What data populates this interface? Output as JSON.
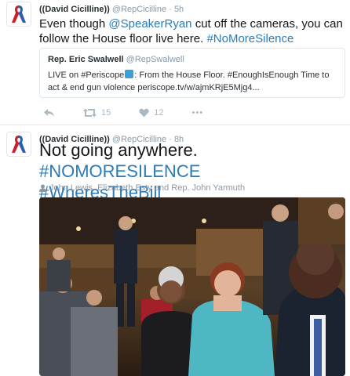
{
  "tweet1": {
    "name": "((David Cicilline))",
    "handle": "@RepCicilline",
    "time": "· 5h",
    "text_part1": "Even though ",
    "mention": "@SpeakerRyan",
    "text_part2": " cut off the cameras, you can follow the House floor live here. ",
    "hashtag": "#NoMoreSilence",
    "quote": {
      "name": "Rep. Eric Swalwell",
      "handle": "@RepSwalwell",
      "text_part1": "LIVE on #Periscope",
      "text_part2": ": From the House Floor. #EnoughIsEnough Time to act & end gun violence periscope.tv/w/ajmKRjE5Mjg4..."
    },
    "retweets": "15",
    "likes": "12",
    "more": "•••"
  },
  "tweet2": {
    "name": "((David Cicilline))",
    "handle": "@RepCicilline",
    "time": "· 8h",
    "text_plain": "Not going anywhere. ",
    "hashtag1": "#NOMORESILENCE",
    "hashtag2": "#WheresTheBill",
    "with_people": "John Lewis, Elizabeth Esty and Rep. John Yarmuth"
  },
  "icons": [
    "ribbon-icon",
    "reply-icon",
    "retweet-icon",
    "like-icon",
    "more-icon",
    "person-icon"
  ],
  "colors": {
    "link": "#2b7bb9",
    "muted": "#8899a6",
    "icon": "#aab8c2",
    "ribbon_red": "#c8202f",
    "ribbon_blue": "#2d5fa8"
  }
}
